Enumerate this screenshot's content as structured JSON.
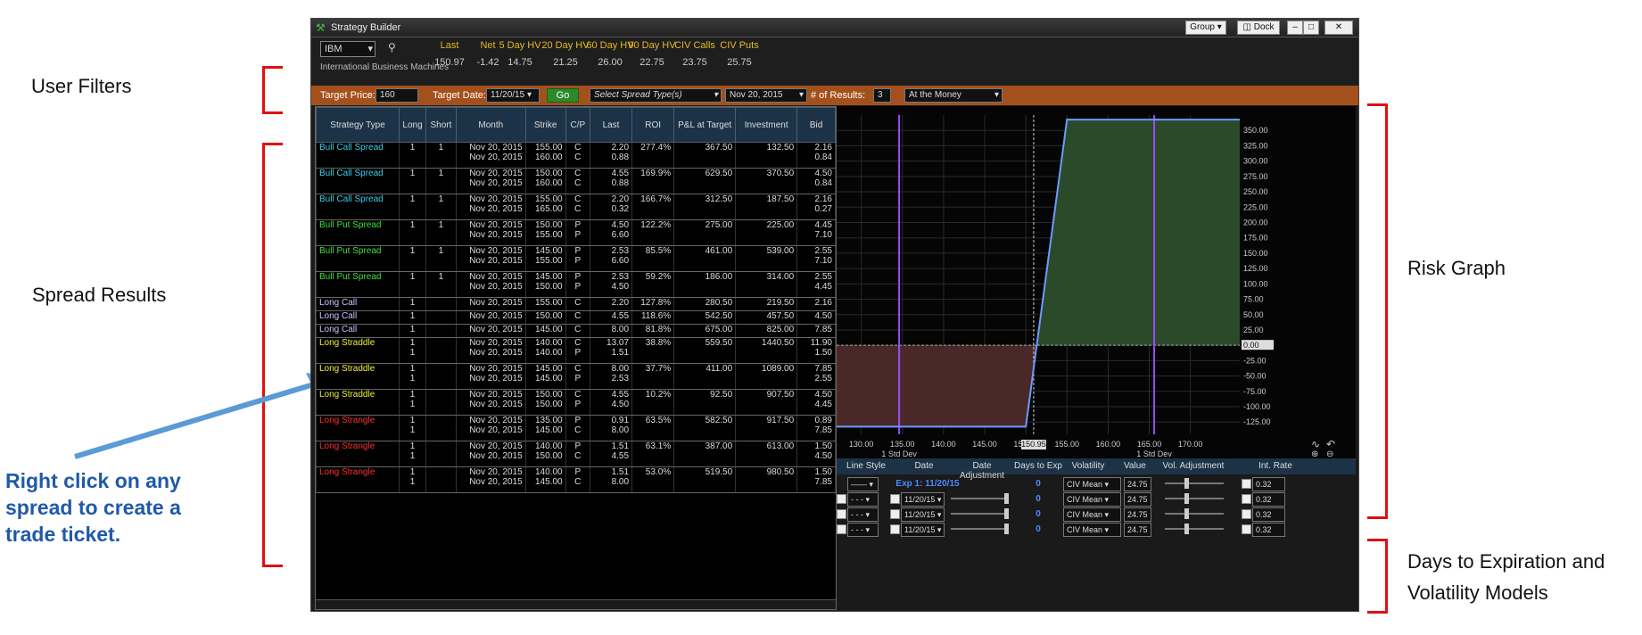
{
  "callouts": {
    "user_filters": "User Filters",
    "spread_results": "Spread Results",
    "right_click": [
      "Right click on any",
      "spread to create a",
      "trade ticket."
    ],
    "risk_graph": "Risk Graph",
    "days_to_exp": [
      "Days to Expiration and",
      "Volatility Models"
    ]
  },
  "colors": {
    "accent_orange": "#a4501d",
    "header_blue": "#1c3246",
    "callout_red": "#e01010",
    "callout_blue": "#1f5aa8"
  },
  "app": {
    "title": "Strategy Builder",
    "window_buttons": [
      "Group",
      "Dock"
    ],
    "symbol": "IBM",
    "company": "International Business Machines",
    "quote_headers": [
      "Last",
      "Net",
      "5 Day HV",
      "20 Day HV",
      "60 Day HV",
      "90 Day HV",
      "CIV Calls",
      "CIV Puts"
    ],
    "quote_values": [
      "150.97",
      "-1.42",
      "14.75",
      "21.25",
      "26.00",
      "22.75",
      "23.75",
      "25.75"
    ]
  },
  "filters": {
    "target_price_label": "Target Price:",
    "target_price": "160",
    "target_date_label": "Target Date:",
    "target_date": "11/20/15",
    "go": "Go",
    "spread_type": "Select Spread Type(s)",
    "expiry": "Nov 20, 2015",
    "results_label": "# of Results:",
    "results": "3",
    "moneyness": "At the Money"
  },
  "table": {
    "columns": [
      "Strategy Type",
      "Long",
      "Short",
      "Month",
      "Strike",
      "C/P",
      "Last",
      "ROI",
      "P&L at Target",
      "Investment",
      "Bid"
    ],
    "rows": [
      {
        "type": "Bull Call Spread",
        "color": "#3ad0e8",
        "long": [
          "1",
          ""
        ],
        "short": [
          "",
          "1"
        ],
        "month": [
          "Nov 20, 2015",
          "Nov 20, 2015"
        ],
        "strike": [
          "155.00",
          "160.00"
        ],
        "cp": [
          "C",
          "C"
        ],
        "last": [
          "2.20",
          "0.88"
        ],
        "roi": "277.4%",
        "pl": "367.50",
        "inv": "132.50",
        "bid": [
          "2.16",
          "0.84"
        ]
      },
      {
        "type": "Bull Call Spread",
        "color": "#3ad0e8",
        "long": [
          "1",
          ""
        ],
        "short": [
          "",
          "1"
        ],
        "month": [
          "Nov 20, 2015",
          "Nov 20, 2015"
        ],
        "strike": [
          "150.00",
          "160.00"
        ],
        "cp": [
          "C",
          "C"
        ],
        "last": [
          "4.55",
          "0.88"
        ],
        "roi": "169.9%",
        "pl": "629.50",
        "inv": "370.50",
        "bid": [
          "4.50",
          "0.84"
        ]
      },
      {
        "type": "Bull Call Spread",
        "color": "#3ad0e8",
        "long": [
          "1",
          ""
        ],
        "short": [
          "",
          "1"
        ],
        "month": [
          "Nov 20, 2015",
          "Nov 20, 2015"
        ],
        "strike": [
          "155.00",
          "165.00"
        ],
        "cp": [
          "C",
          "C"
        ],
        "last": [
          "2.20",
          "0.32"
        ],
        "roi": "166.7%",
        "pl": "312.50",
        "inv": "187.50",
        "bid": [
          "2.16",
          "0.27"
        ]
      },
      {
        "type": "Bull Put Spread",
        "color": "#3fe03f",
        "long": [
          "1",
          ""
        ],
        "short": [
          "",
          "1"
        ],
        "month": [
          "Nov 20, 2015",
          "Nov 20, 2015"
        ],
        "strike": [
          "150.00",
          "155.00"
        ],
        "cp": [
          "P",
          "P"
        ],
        "last": [
          "4.50",
          "6.60"
        ],
        "roi": "122.2%",
        "pl": "275.00",
        "inv": "225.00",
        "bid": [
          "4.45",
          "7.10"
        ]
      },
      {
        "type": "Bull Put Spread",
        "color": "#3fe03f",
        "long": [
          "1",
          ""
        ],
        "short": [
          "",
          "1"
        ],
        "month": [
          "Nov 20, 2015",
          "Nov 20, 2015"
        ],
        "strike": [
          "145.00",
          "155.00"
        ],
        "cp": [
          "P",
          "P"
        ],
        "last": [
          "2.53",
          "6.60"
        ],
        "roi": "85.5%",
        "pl": "461.00",
        "inv": "539.00",
        "bid": [
          "2.55",
          "7.10"
        ]
      },
      {
        "type": "Bull Put Spread",
        "color": "#3fe03f",
        "long": [
          "1",
          ""
        ],
        "short": [
          "",
          "1"
        ],
        "month": [
          "Nov 20, 2015",
          "Nov 20, 2015"
        ],
        "strike": [
          "145.00",
          "150.00"
        ],
        "cp": [
          "P",
          "P"
        ],
        "last": [
          "2.53",
          "4.50"
        ],
        "roi": "59.2%",
        "pl": "186.00",
        "inv": "314.00",
        "bid": [
          "2.55",
          "4.45"
        ]
      },
      {
        "type": "Long Call",
        "color": "#c8c8ff",
        "long": [
          "1"
        ],
        "short": [
          ""
        ],
        "month": [
          "Nov 20, 2015"
        ],
        "strike": [
          "155.00"
        ],
        "cp": [
          "C"
        ],
        "last": [
          "2.20"
        ],
        "roi": "127.8%",
        "pl": "280.50",
        "inv": "219.50",
        "bid": [
          "2.16"
        ]
      },
      {
        "type": "Long Call",
        "color": "#c8c8ff",
        "long": [
          "1"
        ],
        "short": [
          ""
        ],
        "month": [
          "Nov 20, 2015"
        ],
        "strike": [
          "150.00"
        ],
        "cp": [
          "C"
        ],
        "last": [
          "4.55"
        ],
        "roi": "118.6%",
        "pl": "542.50",
        "inv": "457.50",
        "bid": [
          "4.50"
        ]
      },
      {
        "type": "Long Call",
        "color": "#c8c8ff",
        "long": [
          "1"
        ],
        "short": [
          ""
        ],
        "month": [
          "Nov 20, 2015"
        ],
        "strike": [
          "145.00"
        ],
        "cp": [
          "C"
        ],
        "last": [
          "8.00"
        ],
        "roi": "81.8%",
        "pl": "675.00",
        "inv": "825.00",
        "bid": [
          "7.85"
        ]
      },
      {
        "type": "Long Straddle",
        "color": "#f0f040",
        "long": [
          "1",
          "1"
        ],
        "short": [
          "",
          ""
        ],
        "month": [
          "Nov 20, 2015",
          "Nov 20, 2015"
        ],
        "strike": [
          "140.00",
          "140.00"
        ],
        "cp": [
          "C",
          "P"
        ],
        "last": [
          "13.07",
          "1.51"
        ],
        "roi": "38.8%",
        "pl": "559.50",
        "inv": "1440.50",
        "bid": [
          "11.90",
          "1.50"
        ]
      },
      {
        "type": "Long Straddle",
        "color": "#f0f040",
        "long": [
          "1",
          "1"
        ],
        "short": [
          "",
          ""
        ],
        "month": [
          "Nov 20, 2015",
          "Nov 20, 2015"
        ],
        "strike": [
          "145.00",
          "145.00"
        ],
        "cp": [
          "C",
          "P"
        ],
        "last": [
          "8.00",
          "2.53"
        ],
        "roi": "37.7%",
        "pl": "411.00",
        "inv": "1089.00",
        "bid": [
          "7.85",
          "2.55"
        ]
      },
      {
        "type": "Long Straddle",
        "color": "#f0f040",
        "long": [
          "1",
          "1"
        ],
        "short": [
          "",
          ""
        ],
        "month": [
          "Nov 20, 2015",
          "Nov 20, 2015"
        ],
        "strike": [
          "150.00",
          "150.00"
        ],
        "cp": [
          "C",
          "P"
        ],
        "last": [
          "4.55",
          "4.50"
        ],
        "roi": "10.2%",
        "pl": "92.50",
        "inv": "907.50",
        "bid": [
          "4.50",
          "4.45"
        ]
      },
      {
        "type": "Long Strangle",
        "color": "#ff3030",
        "long": [
          "1",
          "1"
        ],
        "short": [
          "",
          ""
        ],
        "month": [
          "Nov 20, 2015",
          "Nov 20, 2015"
        ],
        "strike": [
          "135.00",
          "145.00"
        ],
        "cp": [
          "P",
          "C"
        ],
        "last": [
          "0.91",
          "8.00"
        ],
        "roi": "63.5%",
        "pl": "582.50",
        "inv": "917.50",
        "bid": [
          "0.89",
          "7.85"
        ]
      },
      {
        "type": "Long Strangle",
        "color": "#ff3030",
        "long": [
          "1",
          "1"
        ],
        "short": [
          "",
          ""
        ],
        "month": [
          "Nov 20, 2015",
          "Nov 20, 2015"
        ],
        "strike": [
          "140.00",
          "150.00"
        ],
        "cp": [
          "P",
          "C"
        ],
        "last": [
          "1.51",
          "4.55"
        ],
        "roi": "63.1%",
        "pl": "387.00",
        "inv": "613.00",
        "bid": [
          "1.50",
          "4.50"
        ]
      },
      {
        "type": "Long Strangle",
        "color": "#ff3030",
        "long": [
          "1",
          "1"
        ],
        "short": [
          "",
          ""
        ],
        "month": [
          "Nov 20, 2015",
          "Nov 20, 2015"
        ],
        "strike": [
          "140.00",
          "145.00"
        ],
        "cp": [
          "P",
          "C"
        ],
        "last": [
          "1.51",
          "8.00"
        ],
        "roi": "53.0%",
        "pl": "519.50",
        "inv": "980.50",
        "bid": [
          "1.50",
          "7.85"
        ]
      }
    ]
  },
  "chart_data": {
    "type": "line",
    "x_ticks": [
      "130.00",
      "135.00",
      "140.00",
      "145.00",
      "150.00",
      "155.00",
      "160.00",
      "165.00",
      "170.00"
    ],
    "y_ticks": [
      "350.00",
      "325.00",
      "300.00",
      "275.00",
      "250.00",
      "225.00",
      "200.00",
      "175.00",
      "150.00",
      "125.00",
      "100.00",
      "75.00",
      "50.00",
      "25.00",
      "0.00",
      "-25.00",
      "-50.00",
      "-75.00",
      "-100.00",
      "-125.00"
    ],
    "xlim": [
      127,
      176
    ],
    "ylim": [
      -145,
      375
    ],
    "series": [
      {
        "x": [
          127,
          150,
          155,
          176
        ],
        "y": [
          -132.5,
          -132.5,
          367.5,
          367.5
        ]
      }
    ],
    "current_price": "150.95",
    "std_dev_lines": [
      {
        "x": 134.6,
        "label": "1 Std Dev"
      },
      {
        "x": 165.6,
        "label": "1 Std Dev"
      }
    ],
    "profit_color": "#2a4a2a",
    "loss_color": "#4a2828",
    "line_color": "#6a9cff",
    "std_dev_color": "#9a4cff"
  },
  "vol": {
    "headers": [
      "Line Style",
      "Date",
      "Date Adjustment",
      "Days to Exp",
      "Volatility",
      "Value",
      "Vol. Adjustment",
      "Int. Rate"
    ],
    "exp_label": "Exp 1: 11/20/15",
    "rows": [
      {
        "date": "",
        "days": "0",
        "vol": "CIV Mean",
        "value": "24.75",
        "rate": "0.32"
      },
      {
        "date": "11/20/15",
        "days": "0",
        "vol": "CIV Mean",
        "value": "24.75",
        "rate": "0.32"
      },
      {
        "date": "11/20/15",
        "days": "0",
        "vol": "CIV Mean",
        "value": "24.75",
        "rate": "0.32"
      },
      {
        "date": "11/20/15",
        "days": "0",
        "vol": "CIV Mean",
        "value": "24.75",
        "rate": "0.32"
      }
    ]
  }
}
